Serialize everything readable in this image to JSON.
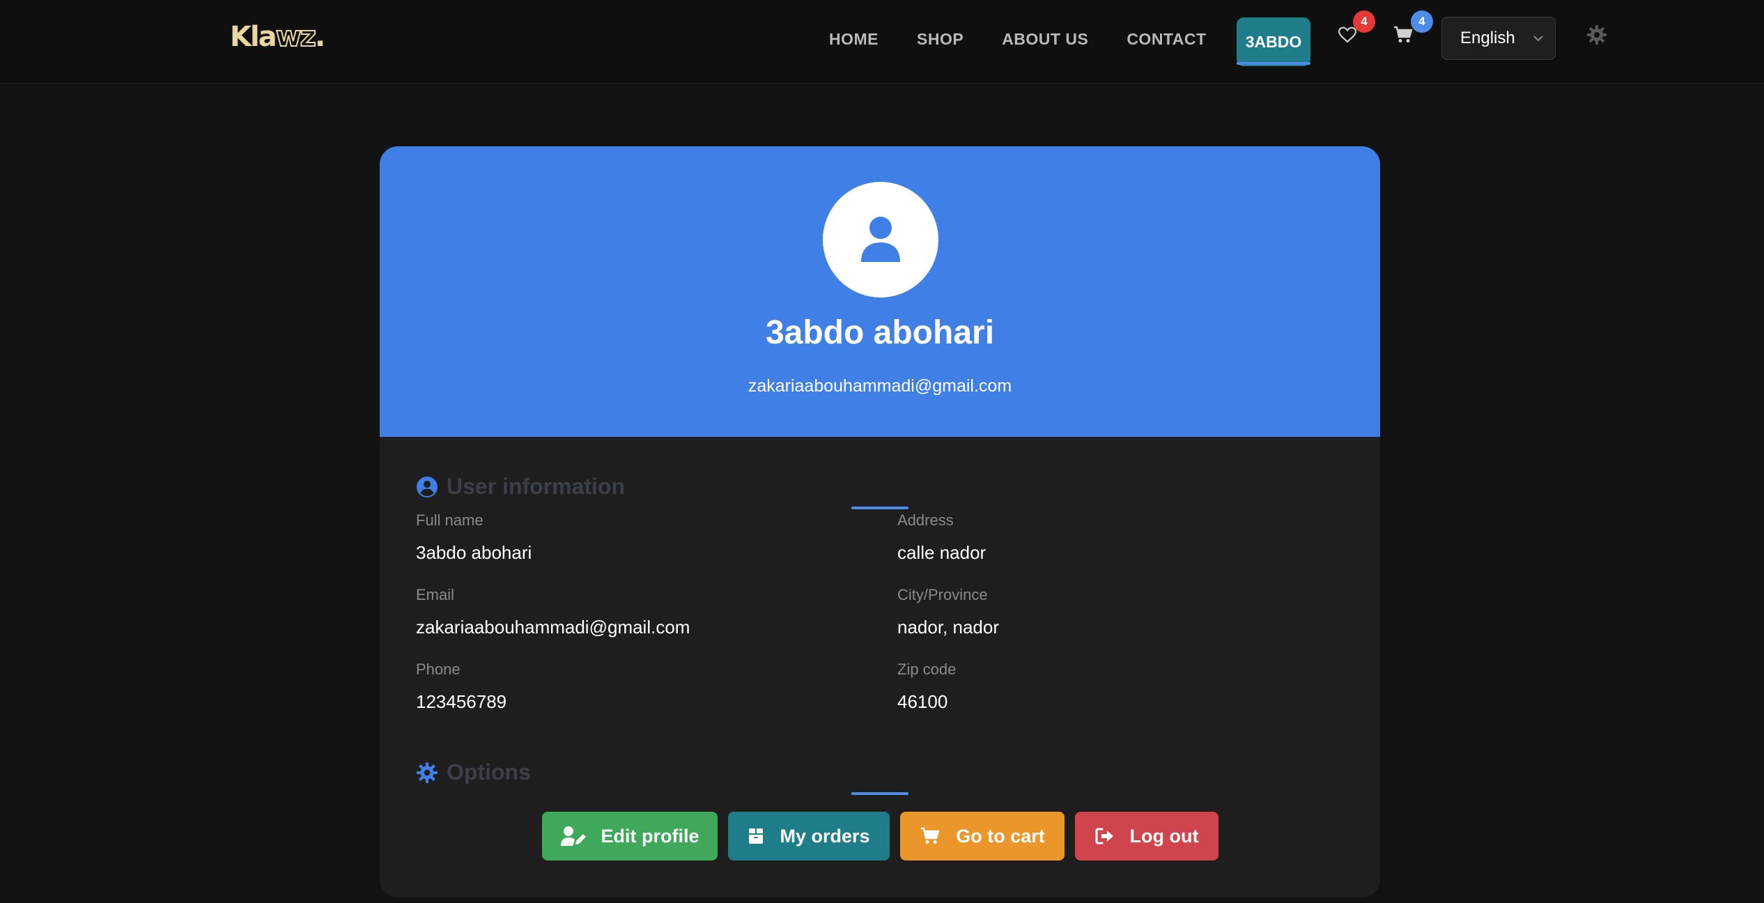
{
  "header": {
    "logo": {
      "part1": "Kla",
      "part2": "wz",
      "dot": "."
    },
    "nav": [
      "HOME",
      "SHOP",
      "ABOUT US",
      "CONTACT"
    ],
    "user_button": "3ABDO",
    "wishlist_count": "4",
    "cart_count": "4",
    "language": "English"
  },
  "profile": {
    "name": "3abdo abohari",
    "email": "zakariaabouhammadi@gmail.com"
  },
  "user_info": {
    "title": "User information",
    "fields": [
      {
        "label": "Full name",
        "value": "3abdo abohari"
      },
      {
        "label": "Email",
        "value": "zakariaabouhammadi@gmail.com"
      },
      {
        "label": "Phone",
        "value": "123456789"
      },
      {
        "label": "Address",
        "value": "calle nador"
      },
      {
        "label": "City/Province",
        "value": "nador, nador"
      },
      {
        "label": "Zip code",
        "value": "46100"
      }
    ]
  },
  "options": {
    "title": "Options",
    "buttons": [
      {
        "label": "Edit profile",
        "color": "#3fa85a",
        "icon": "user-edit-icon"
      },
      {
        "label": "My orders",
        "color": "#1f7d8a",
        "icon": "box-icon"
      },
      {
        "label": "Go to cart",
        "color": "#ea962a",
        "icon": "cart-icon"
      },
      {
        "label": "Log out",
        "color": "#d0454d",
        "icon": "logout-icon"
      }
    ]
  },
  "colors": {
    "primary": "#3f7fe6",
    "background": "#121212",
    "card": "#1e1e1e",
    "badge_red": "#e53935",
    "badge_blue": "#4d8de8"
  }
}
